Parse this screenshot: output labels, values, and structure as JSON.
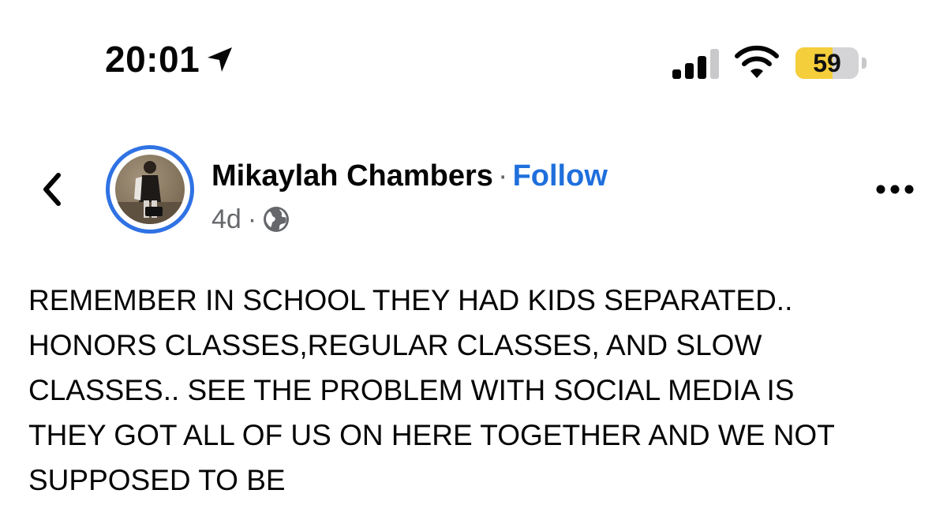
{
  "status_bar": {
    "time": "20:01",
    "battery_level": "59",
    "battery_fraction": 0.59,
    "icons": [
      "location-arrow-icon",
      "cellular-signal-icon",
      "wifi-icon",
      "battery-icon"
    ],
    "colors": {
      "battery_fill": "#f4ce3b",
      "battery_empty": "#d4d4d6"
    }
  },
  "post": {
    "author": "Mikaylah Chambers",
    "separator": "·",
    "follow_label": "Follow",
    "age": "4d",
    "meta_separator": "·",
    "privacy_icon": "globe-icon",
    "text_lines": [
      "REMEMBER IN SCHOOL THEY HAD KIDS SEPARATED..",
      "HONORS CLASSES,REGULAR CLASSES, AND SLOW",
      "CLASSES.. SEE THE PROBLEM WITH SOCIAL MEDIA IS",
      "THEY GOT ALL OF US ON HERE TOGETHER AND WE NOT",
      "SUPPOSED TO BE"
    ]
  },
  "icons": {
    "back": "chevron-left-icon",
    "more": "more-options-icon",
    "avatar": "avatar"
  },
  "colors": {
    "accent": "#1f6fdc",
    "avatar_ring": "#2f72e4",
    "secondary_text": "#65676b",
    "primary_text": "#050505"
  }
}
